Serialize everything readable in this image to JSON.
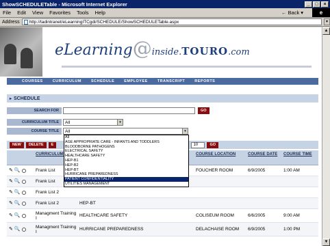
{
  "window": {
    "title": "ShowSCHEDULETable - Microsoft Internet Explorer",
    "minimize": "_",
    "maximize": "□",
    "close": "×"
  },
  "menu": {
    "items": [
      "File",
      "Edit",
      "View",
      "Favorites",
      "Tools",
      "Help"
    ],
    "back_label": "Back",
    "back_arrow": "←",
    "back_drop": "▾",
    "ie_logo": "e"
  },
  "address": {
    "label": "Address",
    "url": "http://tadintranet/eLearningITCgdi/SCHEDULE/ShowSCHEDULETable.aspx",
    "drop": "▾"
  },
  "banner": {
    "logo_main": "eLearning",
    "logo_at": "@",
    "logo_inside": "inside.",
    "logo_brand": "TOURO",
    "logo_tld": ".com"
  },
  "nav": {
    "items": [
      "COURSES",
      "CURRICULUM",
      "SCHEDULE",
      "EMPLOYEE",
      "TRANSCRIPT",
      "REPORTS"
    ]
  },
  "section": {
    "title": "SCHEDULE",
    "marker": "▸"
  },
  "filters": {
    "search_label": "SEARCH FOR",
    "search_value": "",
    "curriculum_label": "CURRICULUM TITLE",
    "curriculum_value": "All",
    "course_label": "COURSE TITLE",
    "course_value": "All",
    "go_label": "GO",
    "dropdown_arrow": "▾"
  },
  "course_options": [
    "All",
    "AGE APPROPRIATE CARE - INFANTS AND TODDLERS",
    "BLOODBORNE PATHOGENS",
    "ELECTRICAL SAFETY",
    "HEALTHCARE SAFETY",
    "HEP-B1",
    "HEP-B2",
    "HEP-BT",
    "HURRICANE PREPAREDNESS",
    "PATIENT CONFIDENTIALITY",
    "UTILITIES MANAGEMENT"
  ],
  "course_selected_index": 9,
  "toolbar": {
    "new": "NEW",
    "delete": "DELETE",
    "third": "E",
    "page_size": "10",
    "go": "GO"
  },
  "table": {
    "headers": [
      "CURRICULUM TITLE",
      "",
      "COURSE LOCATION",
      "COURSE DATE",
      "COURSE TIME"
    ],
    "rows": [
      {
        "curriculum": "Frank List",
        "course": "",
        "location": "FOUCHER ROOM",
        "date": "6/9/2005",
        "time": "1:00 AM"
      },
      {
        "curriculum": "Frank List",
        "course": "",
        "location": "",
        "date": "",
        "time": ""
      },
      {
        "curriculum": "Frank List 2",
        "course": "",
        "location": "",
        "date": "",
        "time": ""
      },
      {
        "curriculum": "Frank List 2",
        "course": "HEP-BT",
        "location": "",
        "date": "",
        "time": ""
      },
      {
        "curriculum": "Managment Training I",
        "course": "HEALTHCARE SAFETY",
        "location": "COLISEUM ROOM",
        "date": "6/6/2005",
        "time": "9:00 AM"
      },
      {
        "curriculum": "Managment Training I",
        "course": "HURRICANE PREPAREDNESS",
        "location": "DELACHAISE ROOM",
        "date": "6/9/2005",
        "time": "1:00 PM"
      }
    ]
  },
  "icons": {
    "edit": "✎",
    "view": "🔍"
  },
  "scroll": {
    "up": "▲",
    "down": "▼"
  }
}
